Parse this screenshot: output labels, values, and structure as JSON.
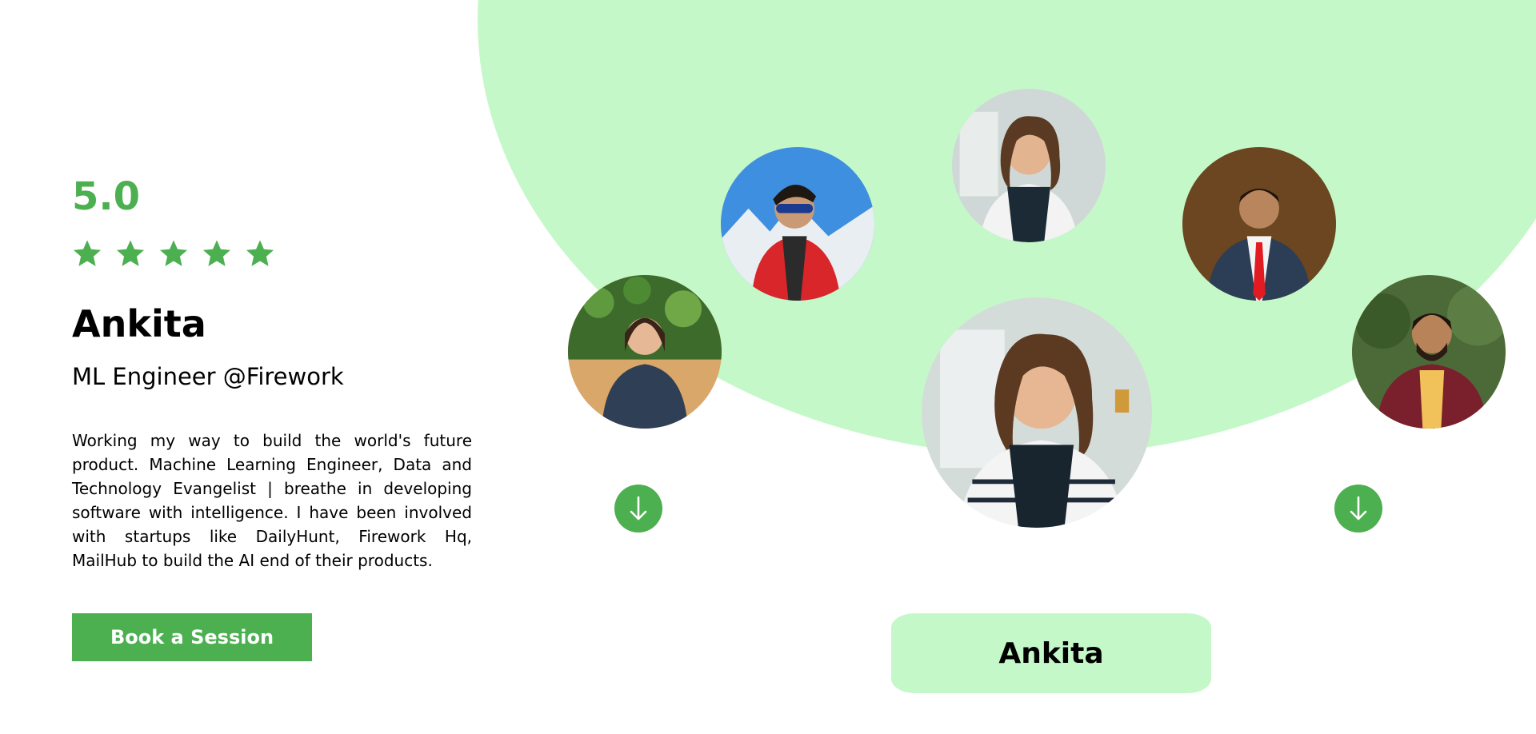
{
  "mentor": {
    "rating": "5.0",
    "star_count": 5,
    "name": "Ankita",
    "role": "ML Engineer @Firework",
    "bio": "Working my way to build the world's future product. Machine Learning Engineer, Data and Technology Evangelist | breathe in developing software with intelligence. I have been involved with startups like DailyHunt, Firework Hq, MailHub to build the AI end of their products.",
    "book_label": "Book a Session"
  },
  "carousel": {
    "selected_name": "Ankita",
    "prev_icon": "arrow-down-icon",
    "next_icon": "arrow-down-icon"
  },
  "colors": {
    "accent": "#4caf50",
    "blob": "#c5f8c8",
    "text": "#000000"
  }
}
